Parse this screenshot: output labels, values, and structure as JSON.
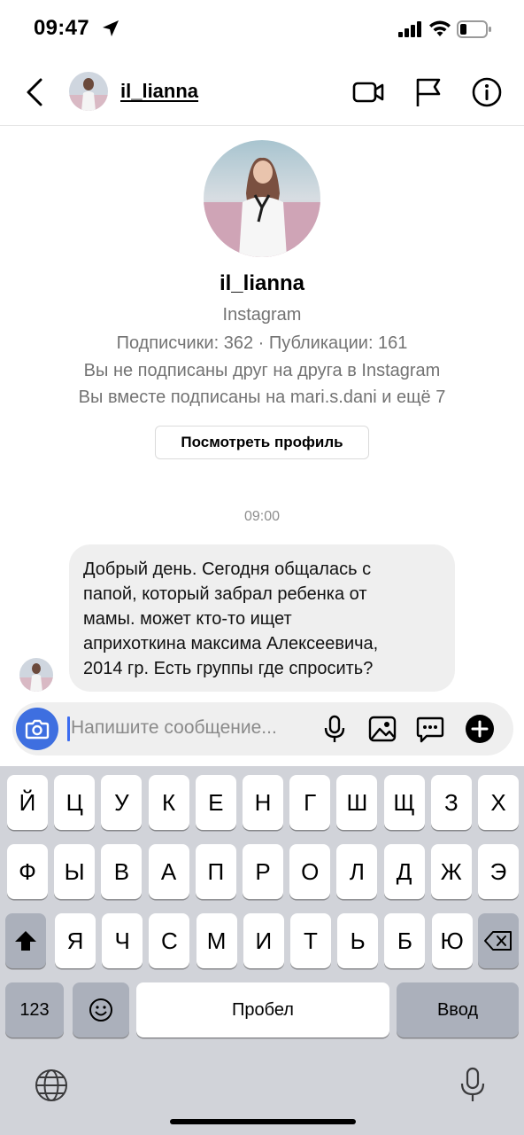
{
  "status_bar": {
    "time": "09:47"
  },
  "header": {
    "username": "il_lianna"
  },
  "profile": {
    "username": "il_lianna",
    "platform": "Instagram",
    "stats": "Подписчики: 362 · Публикации: 161",
    "follow_status": "Вы не подписаны друг на друга в Instagram",
    "mutual": "Вы вместе подписаны на mari.s.dani и ещё 7",
    "view_profile_label": "Посмотреть профиль"
  },
  "conversation": {
    "timestamp": "09:00",
    "messages": [
      {
        "lines": [
          "Добрый день. Сегодня общалась с",
          "папой, который забрал ребенка от",
          "мамы. может кто-то ищет",
          "априхоткина максима Алексеевича,",
          "2014 гр.  Есть группы где спросить?"
        ]
      }
    ]
  },
  "composer": {
    "placeholder": "Напишите сообщение..."
  },
  "keyboard": {
    "row1": [
      "Й",
      "Ц",
      "У",
      "К",
      "Е",
      "Н",
      "Г",
      "Ш",
      "Щ",
      "З",
      "Х"
    ],
    "row2": [
      "Ф",
      "Ы",
      "В",
      "А",
      "П",
      "Р",
      "О",
      "Л",
      "Д",
      "Ж",
      "Э"
    ],
    "row3": [
      "Я",
      "Ч",
      "С",
      "М",
      "И",
      "Т",
      "Ь",
      "Б",
      "Ю"
    ],
    "numbers_label": "123",
    "space_label": "Пробел",
    "return_label": "Ввод"
  },
  "colors": {
    "accent": "#3e6fe0",
    "bubble": "#efefef",
    "keyboard_bg": "#d1d3d9"
  }
}
